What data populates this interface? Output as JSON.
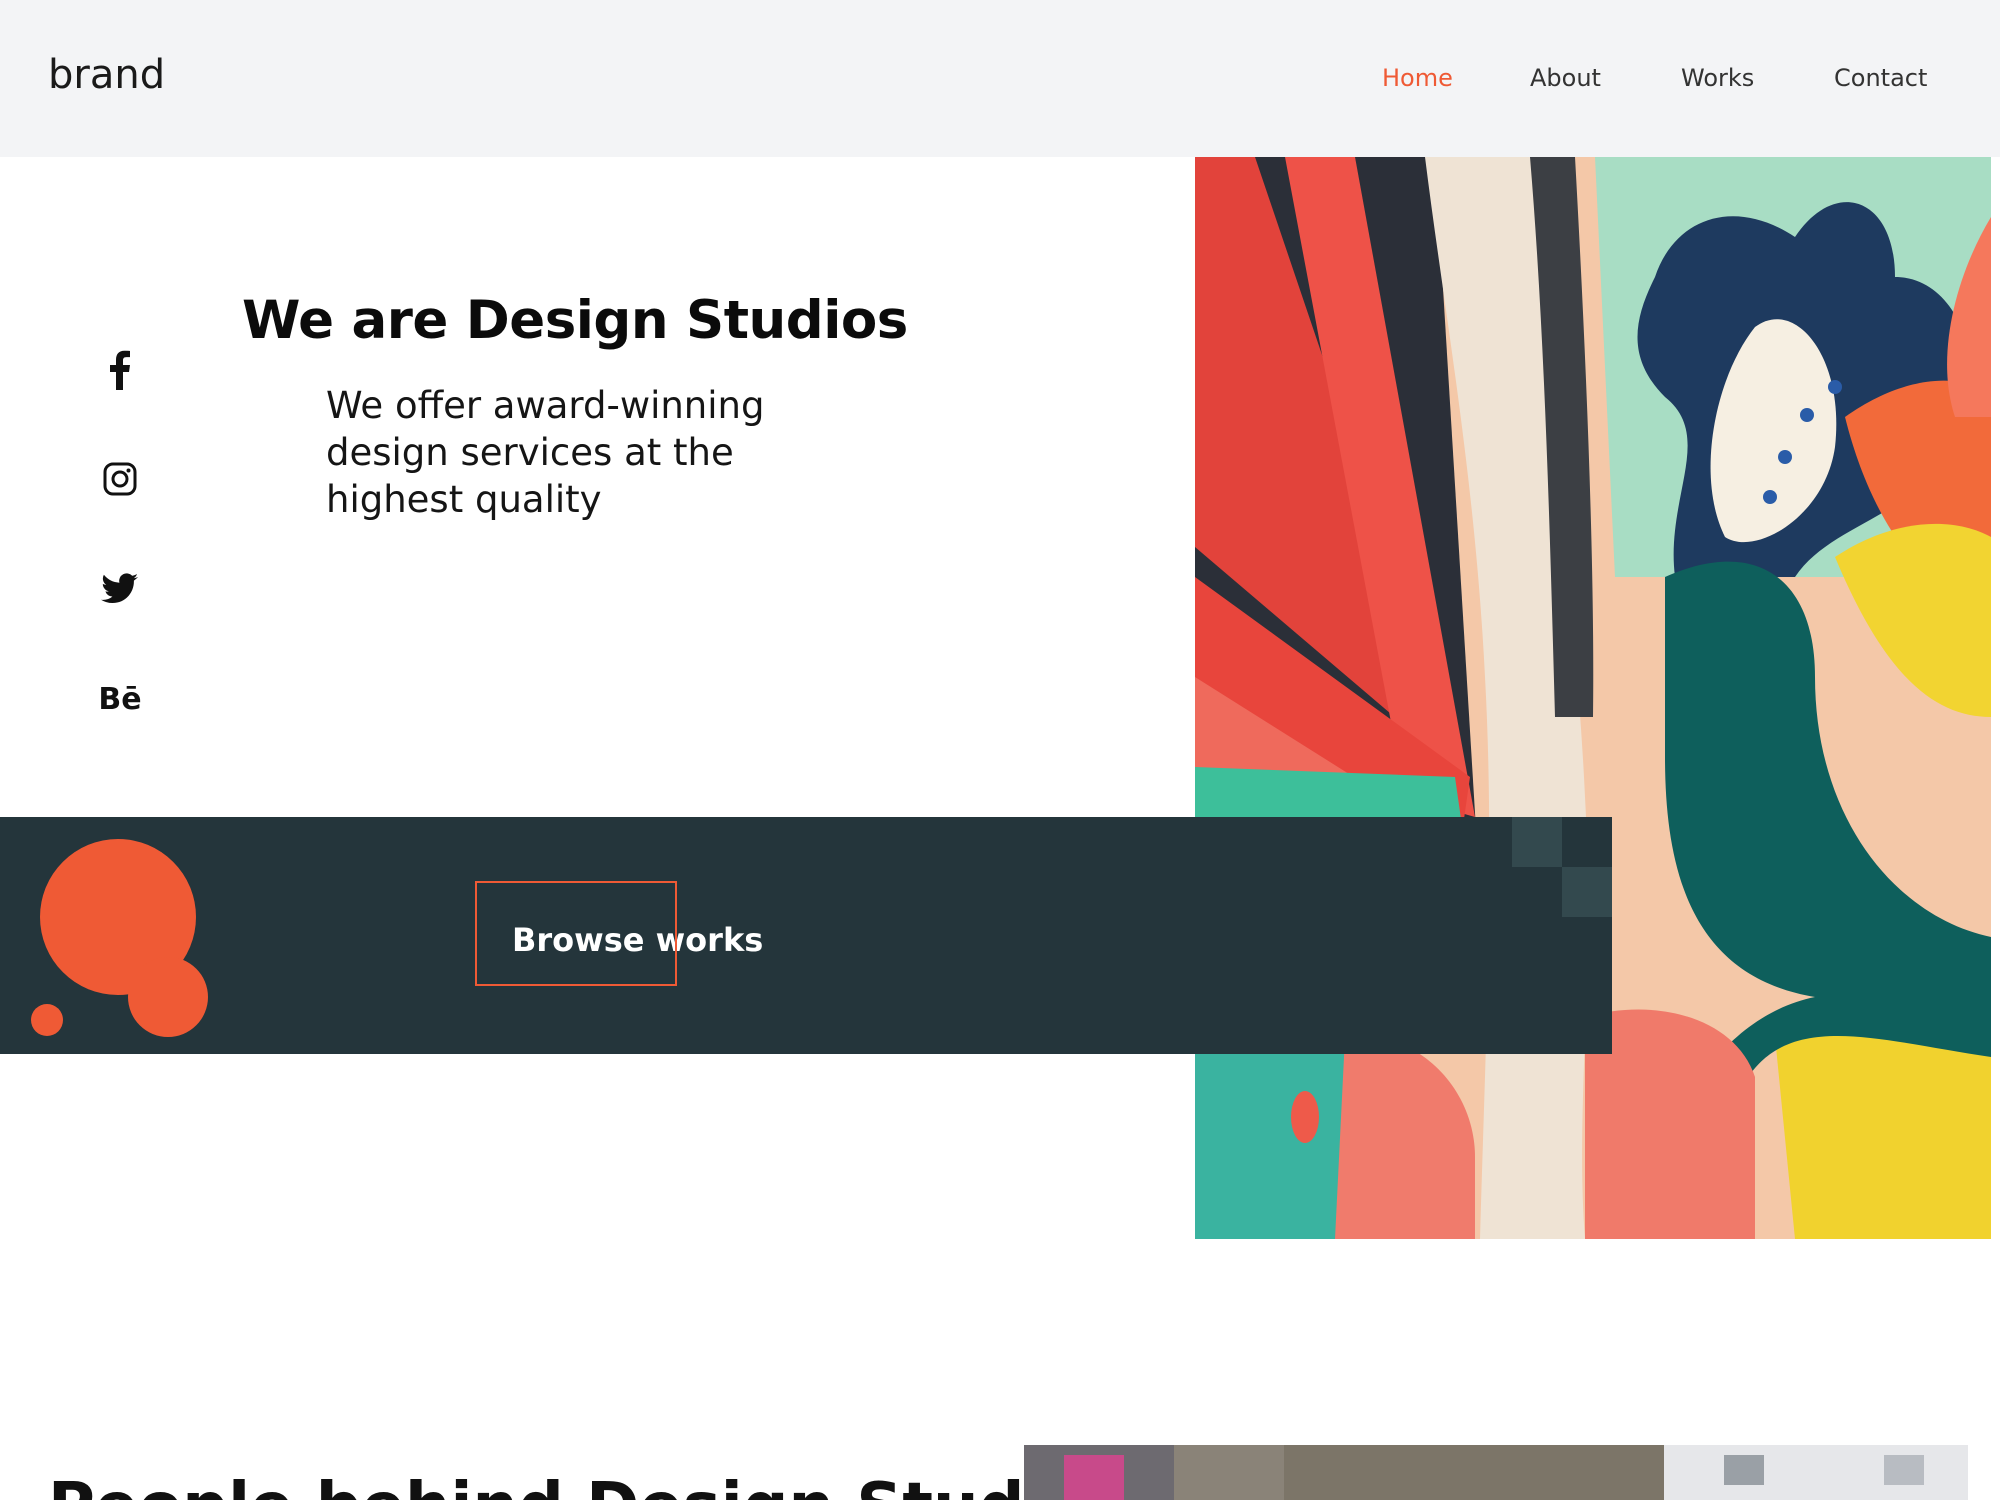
{
  "header": {
    "brand": "brand",
    "nav": [
      {
        "label": "Home",
        "active": true
      },
      {
        "label": "About",
        "active": false
      },
      {
        "label": "Works",
        "active": false
      },
      {
        "label": "Contact",
        "active": false
      }
    ]
  },
  "social": {
    "icons": [
      "facebook-icon",
      "instagram-icon",
      "twitter-icon",
      "behance-icon"
    ],
    "behance_text": "Bē"
  },
  "hero": {
    "title": "We are Design Studios",
    "subtitle": "We offer award-winning design services at the highest quality"
  },
  "band": {
    "browse_label": "Browse works"
  },
  "lower": {
    "title": "People behind Design Studio"
  },
  "colors": {
    "accent": "#ef5a35",
    "band": "#24353b",
    "header_bg": "#f3f4f6"
  }
}
